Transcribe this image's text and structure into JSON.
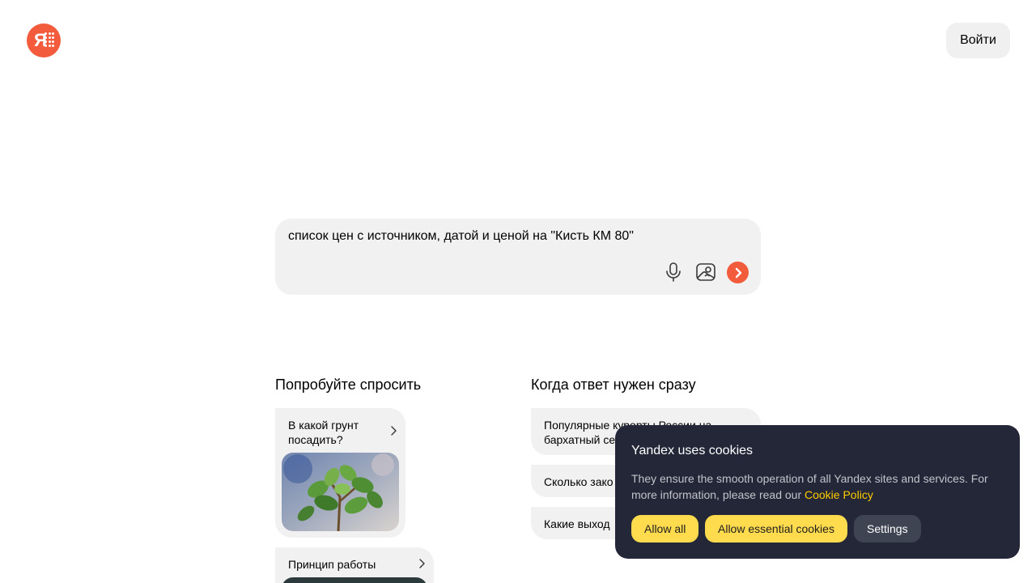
{
  "header": {
    "login_label": "Войти"
  },
  "logo": {
    "letter": "Я",
    "icon": "yandex-alice-logo",
    "color": "#f25b3c"
  },
  "query": {
    "text": "список цен с источником, датой и ценой на \"Кисть КМ 80\"",
    "icons": [
      "microphone-icon",
      "image-search-icon",
      "send-arrow-icon"
    ]
  },
  "sections": {
    "try_asking": {
      "title": "Попробуйте спросить",
      "cards": [
        {
          "line1": "В какой грунт",
          "line2": "посадить?"
        },
        {
          "line1": "Принцип работы",
          "line2": ""
        }
      ]
    },
    "instant_answer": {
      "title": "Когда ответ нужен сразу",
      "items": [
        {
          "line1": "Популярные курорты России на",
          "line2": "бархатный се"
        },
        {
          "line1": "Сколько зако",
          "line2": ""
        },
        {
          "line1": "Какие выход",
          "line2": ""
        }
      ]
    }
  },
  "cookie_banner": {
    "title": "Yandex uses cookies",
    "description": "They ensure the smooth operation of all Yandex sites and services. For more information, please read our",
    "link_label": "Cookie Policy",
    "buttons": {
      "allow_all": "Allow all",
      "allow_essential": "Allow essential cookies",
      "settings": "Settings"
    },
    "colors": {
      "background": "#232737",
      "accent": "#ffdb4d",
      "link": "#ffcc00"
    }
  }
}
